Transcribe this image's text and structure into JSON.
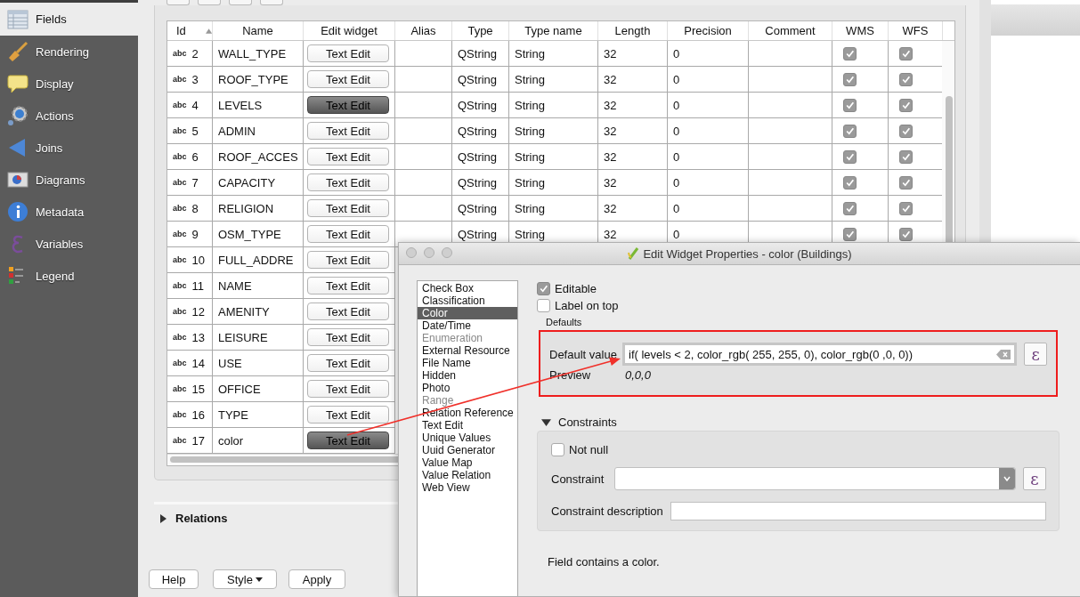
{
  "sidebar": {
    "items": [
      {
        "label": "Fields",
        "selected": true
      },
      {
        "label": "Rendering",
        "selected": false
      },
      {
        "label": "Display",
        "selected": false
      },
      {
        "label": "Actions",
        "selected": false
      },
      {
        "label": "Joins",
        "selected": false
      },
      {
        "label": "Diagrams",
        "selected": false
      },
      {
        "label": "Metadata",
        "selected": false
      },
      {
        "label": "Variables",
        "selected": false
      },
      {
        "label": "Legend",
        "selected": false
      }
    ]
  },
  "fields_table": {
    "columns": [
      {
        "label": "Id",
        "sorted": true
      },
      {
        "label": "Name"
      },
      {
        "label": "Edit widget"
      },
      {
        "label": "Alias"
      },
      {
        "label": "Type"
      },
      {
        "label": "Type name"
      },
      {
        "label": "Length"
      },
      {
        "label": "Precision"
      },
      {
        "label": "Comment"
      },
      {
        "label": "WMS"
      },
      {
        "label": "WFS"
      }
    ],
    "rows": [
      {
        "type_icon": "abc",
        "id": "2",
        "name": "WALL_TYPE",
        "edit_widget": "Text Edit",
        "selected": false,
        "type": "QString",
        "type_name": "String",
        "length": "32",
        "precision": "0",
        "wms": true,
        "wfs": true
      },
      {
        "type_icon": "abc",
        "id": "3",
        "name": "ROOF_TYPE",
        "edit_widget": "Text Edit",
        "selected": false,
        "type": "QString",
        "type_name": "String",
        "length": "32",
        "precision": "0",
        "wms": true,
        "wfs": true
      },
      {
        "type_icon": "abc",
        "id": "4",
        "name": "LEVELS",
        "edit_widget": "Text Edit",
        "selected": true,
        "type": "QString",
        "type_name": "String",
        "length": "32",
        "precision": "0",
        "wms": true,
        "wfs": true
      },
      {
        "type_icon": "abc",
        "id": "5",
        "name": "ADMIN",
        "edit_widget": "Text Edit",
        "selected": false,
        "type": "QString",
        "type_name": "String",
        "length": "32",
        "precision": "0",
        "wms": true,
        "wfs": true
      },
      {
        "type_icon": "abc",
        "id": "6",
        "name": "ROOF_ACCES",
        "edit_widget": "Text Edit",
        "selected": false,
        "type": "QString",
        "type_name": "String",
        "length": "32",
        "precision": "0",
        "wms": true,
        "wfs": true
      },
      {
        "type_icon": "abc",
        "id": "7",
        "name": "CAPACITY",
        "edit_widget": "Text Edit",
        "selected": false,
        "type": "QString",
        "type_name": "String",
        "length": "32",
        "precision": "0",
        "wms": true,
        "wfs": true
      },
      {
        "type_icon": "abc",
        "id": "8",
        "name": "RELIGION",
        "edit_widget": "Text Edit",
        "selected": false,
        "type": "QString",
        "type_name": "String",
        "length": "32",
        "precision": "0",
        "wms": true,
        "wfs": true
      },
      {
        "type_icon": "abc",
        "id": "9",
        "name": "OSM_TYPE",
        "edit_widget": "Text Edit",
        "selected": false,
        "type": "QString",
        "type_name": "String",
        "length": "32",
        "precision": "0",
        "wms": true,
        "wfs": true
      },
      {
        "type_icon": "abc",
        "id": "10",
        "name": "FULL_ADDRE",
        "edit_widget": "Text Edit",
        "selected": false
      },
      {
        "type_icon": "abc",
        "id": "11",
        "name": "NAME",
        "edit_widget": "Text Edit",
        "selected": false
      },
      {
        "type_icon": "abc",
        "id": "12",
        "name": "AMENITY",
        "edit_widget": "Text Edit",
        "selected": false
      },
      {
        "type_icon": "abc",
        "id": "13",
        "name": "LEISURE",
        "edit_widget": "Text Edit",
        "selected": false
      },
      {
        "type_icon": "abc",
        "id": "14",
        "name": "USE",
        "edit_widget": "Text Edit",
        "selected": false
      },
      {
        "type_icon": "abc",
        "id": "15",
        "name": "OFFICE",
        "edit_widget": "Text Edit",
        "selected": false
      },
      {
        "type_icon": "abc",
        "id": "16",
        "name": "TYPE",
        "edit_widget": "Text Edit",
        "selected": false
      },
      {
        "type_icon": "abc",
        "id": "17",
        "name": "color",
        "edit_widget": "Text Edit",
        "selected": true
      }
    ]
  },
  "relations": {
    "label": "Relations",
    "expanded": false
  },
  "buttons": [
    {
      "label": "Help",
      "kind": "plain"
    },
    {
      "label": "Style",
      "kind": "menu"
    },
    {
      "label": "Apply",
      "kind": "plain"
    }
  ],
  "dialog": {
    "title": "Edit Widget Properties - color (Buildings)",
    "widget_types": [
      {
        "label": "Check Box",
        "selected": false,
        "disabled": false
      },
      {
        "label": "Classification",
        "selected": false,
        "disabled": false
      },
      {
        "label": "Color",
        "selected": true,
        "disabled": false
      },
      {
        "label": "Date/Time",
        "selected": false,
        "disabled": false
      },
      {
        "label": "Enumeration",
        "selected": false,
        "disabled": true
      },
      {
        "label": "External Resource",
        "selected": false,
        "disabled": false
      },
      {
        "label": "File Name",
        "selected": false,
        "disabled": false
      },
      {
        "label": "Hidden",
        "selected": false,
        "disabled": false
      },
      {
        "label": "Photo",
        "selected": false,
        "disabled": false
      },
      {
        "label": "Range",
        "selected": false,
        "disabled": true
      },
      {
        "label": "Relation Reference",
        "selected": false,
        "disabled": false
      },
      {
        "label": "Text Edit",
        "selected": false,
        "disabled": false
      },
      {
        "label": "Unique Values",
        "selected": false,
        "disabled": false
      },
      {
        "label": "Uuid Generator",
        "selected": false,
        "disabled": false
      },
      {
        "label": "Value Map",
        "selected": false,
        "disabled": false
      },
      {
        "label": "Value Relation",
        "selected": false,
        "disabled": false
      },
      {
        "label": "Web View",
        "selected": false,
        "disabled": false
      }
    ],
    "editable": {
      "label": "Editable",
      "checked": true
    },
    "label_on_top": {
      "label": "Label on top",
      "checked": false
    },
    "defaults": {
      "title": "Defaults",
      "default_value_label": "Default value",
      "default_value": "if( levels < 2,  color_rgb( 255, 255, 0), color_rgb(0 ,0, 0))",
      "preview_label": "Preview",
      "preview": "0,0,0",
      "expression_symbol": "ε"
    },
    "constraints": {
      "title": "Constraints",
      "expanded": true,
      "not_null": {
        "label": "Not null",
        "checked": false
      },
      "constraint_label": "Constraint",
      "expression_symbol": "ε",
      "description_label": "Constraint description"
    },
    "description": "Field contains a color."
  }
}
